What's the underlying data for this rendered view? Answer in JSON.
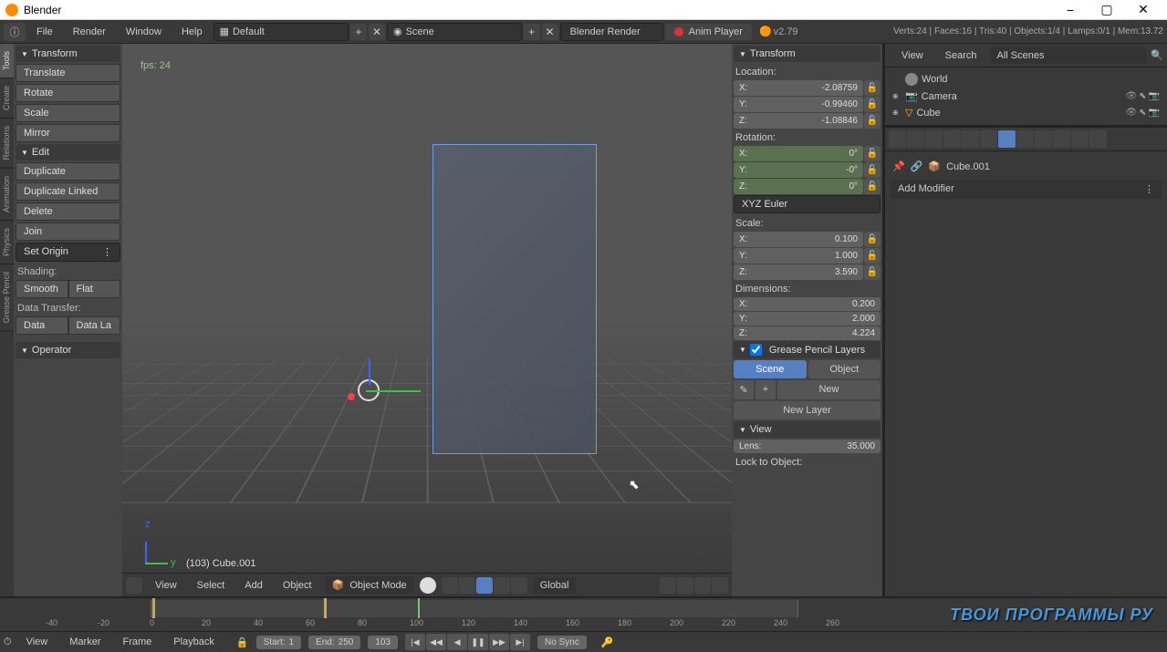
{
  "title_bar": {
    "title": "Blender"
  },
  "top_menu": {
    "items": [
      "File",
      "Render",
      "Window",
      "Help"
    ],
    "layout_dd": "Default",
    "scene_label": "Scene",
    "render_engine": "Blender Render",
    "anim_player": "Anim Player",
    "version": "v2.79",
    "stats": "Verts:24 | Faces:16 | Tris:40 | Objects:1/4 | Lamps:0/1 | Mem:13.72"
  },
  "tool_panel": {
    "tabs": [
      "Tools",
      "Create",
      "Relations",
      "Animation",
      "Physics",
      "Grease Pencil"
    ],
    "transform_header": "Transform",
    "translate": "Translate",
    "rotate": "Rotate",
    "scale": "Scale",
    "mirror": "Mirror",
    "edit_header": "Edit",
    "duplicate": "Duplicate",
    "duplicate_linked": "Duplicate Linked",
    "delete": "Delete",
    "join": "Join",
    "set_origin": "Set Origin",
    "shading_label": "Shading:",
    "smooth": "Smooth",
    "flat": "Flat",
    "data_transfer_label": "Data Transfer:",
    "data": "Data",
    "data_la": "Data La",
    "operator_header": "Operator"
  },
  "viewport": {
    "fps": "fps: 24",
    "object_label": "(103) Cube.001",
    "header": {
      "view": "View",
      "select": "Select",
      "add": "Add",
      "object": "Object",
      "mode": "Object Mode",
      "orientation": "Global"
    }
  },
  "n_panel": {
    "transform_header": "Transform",
    "location_label": "Location:",
    "loc": {
      "x_label": "X:",
      "x": "-2.08759",
      "y_label": "Y:",
      "y": "-0.99460",
      "z_label": "Z:",
      "z": "-1.08846"
    },
    "rotation_label": "Rotation:",
    "rot": {
      "x_label": "X:",
      "x": "0°",
      "y_label": "Y:",
      "y": "-0°",
      "z_label": "Z:",
      "z": "0°"
    },
    "rot_mode": "XYZ Euler",
    "scale_label": "Scale:",
    "scl": {
      "x_label": "X:",
      "x": "0.100",
      "y_label": "Y:",
      "y": "1.000",
      "z_label": "Z:",
      "z": "3.590"
    },
    "dim_label": "Dimensions:",
    "dim": {
      "x_label": "X:",
      "x": "0.200",
      "y_label": "Y:",
      "y": "2.000",
      "z_label": "Z:",
      "z": "4.224"
    },
    "gp_header": "Grease Pencil Layers",
    "gp_scene": "Scene",
    "gp_object": "Object",
    "gp_new": "New",
    "gp_new_layer": "New Layer",
    "view_header": "View",
    "lens_label": "Lens:",
    "lens": "35.000",
    "lock_label": "Lock to Object:"
  },
  "outliner": {
    "view": "View",
    "search": "Search",
    "filter": "All Scenes",
    "items": [
      {
        "name": "World",
        "type": "world"
      },
      {
        "name": "Camera",
        "type": "camera"
      },
      {
        "name": "Cube",
        "type": "mesh"
      }
    ]
  },
  "properties": {
    "object_name": "Cube.001",
    "add_modifier": "Add Modifier"
  },
  "timeline": {
    "ticks": [
      "-40",
      "-20",
      "0",
      "20",
      "40",
      "60",
      "80",
      "100",
      "120",
      "140",
      "160",
      "180",
      "200",
      "220",
      "240",
      "260"
    ],
    "header": {
      "view": "View",
      "marker": "Marker",
      "frame": "Frame",
      "playback": "Playback",
      "start_label": "Start:",
      "start": "1",
      "end_label": "End:",
      "end": "250",
      "current": "103",
      "sync": "No Sync"
    }
  },
  "watermark": "ТВОИ ПРОГРАММЫ РУ"
}
